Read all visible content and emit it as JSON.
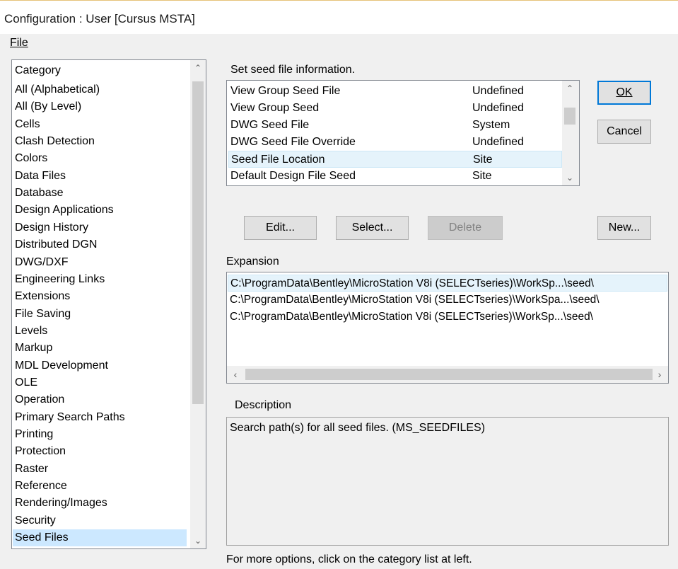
{
  "window": {
    "title": "Configuration : User [Cursus MSTA]"
  },
  "menu": {
    "file": "File"
  },
  "category": {
    "header": "Category",
    "items": [
      "All (Alphabetical)",
      "All (By Level)",
      "Cells",
      "Clash Detection",
      "Colors",
      "Data Files",
      "Database",
      "Design Applications",
      "Design History",
      "Distributed DGN",
      "DWG/DXF",
      "Engineering Links",
      "Extensions",
      "File Saving",
      "Levels",
      "Markup",
      "MDL Development",
      "OLE",
      "Operation",
      "Primary Search Paths",
      "Printing",
      "Protection",
      "Raster",
      "Reference",
      "Rendering/Images",
      "Security",
      "Seed Files"
    ],
    "selected": "Seed Files"
  },
  "seed": {
    "heading": "Set seed file information.",
    "rows": [
      {
        "name": "View Group Seed File",
        "value": "Undefined"
      },
      {
        "name": "View Group Seed",
        "value": "Undefined"
      },
      {
        "name": "DWG Seed File",
        "value": "System"
      },
      {
        "name": "DWG Seed File Override",
        "value": "Undefined"
      },
      {
        "name": "Seed File Location",
        "value": "Site"
      },
      {
        "name": "Default Design File Seed",
        "value": "Site"
      }
    ],
    "selected": "Seed File Location"
  },
  "buttons": {
    "ok": "OK",
    "cancel": "Cancel",
    "edit": "Edit...",
    "select": "Select...",
    "delete": "Delete",
    "new": "New..."
  },
  "expansion": {
    "label": "Expansion",
    "rows": [
      "C:\\ProgramData\\Bentley\\MicroStation V8i (SELECTseries)\\WorkSp...\\seed\\",
      "C:\\ProgramData\\Bentley\\MicroStation V8i (SELECTseries)\\WorkSpa...\\seed\\",
      "C:\\ProgramData\\Bentley\\MicroStation V8i (SELECTseries)\\WorkSp...\\seed\\"
    ]
  },
  "description": {
    "label": "Description",
    "text": "Search path(s) for all seed files.  (MS_SEEDFILES)"
  },
  "footer": {
    "hint": "For more options, click on the category list at left."
  }
}
